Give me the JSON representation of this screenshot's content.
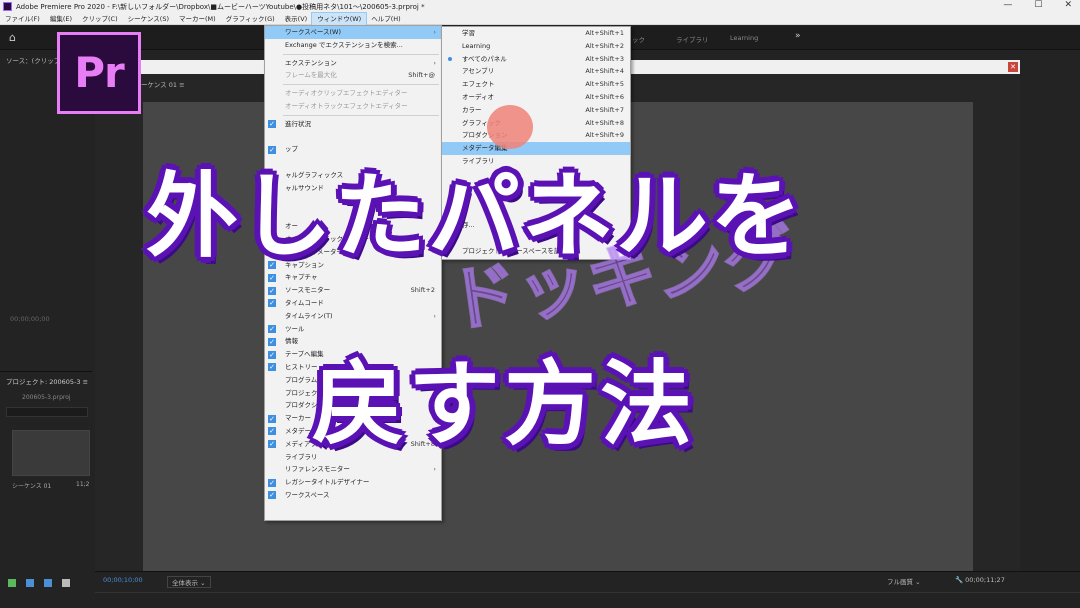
{
  "titlebar": {
    "title": "Adobe Premiere Pro 2020 - F:\\新しいフォルダー\\Dropbox\\■ムービーハーツYoutube\\●投稿用ネタ\\101～\\200605-3.prproj *",
    "min": "—",
    "max": "☐",
    "close": "✕"
  },
  "menubar": {
    "items": [
      "ファイル(F)",
      "編集(E)",
      "クリップ(C)",
      "シーケンス(S)",
      "マーカー(M)",
      "グラフィック(G)",
      "表示(V)",
      "ウィンドウ(W)",
      "ヘルプ(H)"
    ]
  },
  "workspacebar": {
    "home_icon": "⌂",
    "tabs": [
      "ック",
      "ライブラリ",
      "Learning"
    ],
    "more": "»"
  },
  "source_panel": {
    "tab": "ソース：(クリップ",
    "timecode": "00;00;00;00"
  },
  "program_panel": {
    "sequence": "ーケンス 01",
    "menu_icon": "≡"
  },
  "project_panel": {
    "tab": "プロジェクト: 200605-3",
    "menu_icon": "≡",
    "file": "200605-3.prproj",
    "sequence_label": "シーケンス 01",
    "sequence_duration": "11;2"
  },
  "bottom_bar": {
    "timecode_left": "00;00;10;00",
    "fit": "全体表示",
    "fit_arrow": "⌄",
    "quality": "フル画質",
    "quality_arrow": "⌄",
    "wrench_icon": "🔧",
    "timecode_right": "00;00;11;27"
  },
  "logo": {
    "text": "Pr"
  },
  "window_menu": {
    "items": [
      {
        "label": "ワークスペース(W)",
        "shortcut": "",
        "submenu": true,
        "checked": false,
        "disabled": false,
        "highlight": true
      },
      {
        "label": "Exchange でエクステンションを検索...",
        "shortcut": "",
        "submenu": false,
        "checked": false,
        "disabled": false
      },
      {
        "sep": true
      },
      {
        "label": "エクステンション",
        "shortcut": "",
        "submenu": true,
        "checked": false,
        "disabled": false
      },
      {
        "label": "フレームを最大化",
        "shortcut": "Shift+@",
        "submenu": false,
        "checked": false,
        "disabled": true
      },
      {
        "sep": true
      },
      {
        "label": "オーディオクリップエフェクトエディター",
        "shortcut": "",
        "submenu": false,
        "checked": false,
        "disabled": true
      },
      {
        "label": "オーディオトラックエフェクトエディター",
        "shortcut": "",
        "submenu": false,
        "checked": false,
        "disabled": true
      },
      {
        "sep": true
      },
      {
        "label": "進行状況",
        "shortcut": "",
        "submenu": false,
        "checked": true,
        "disabled": false
      },
      {
        "label": "",
        "shortcut": "",
        "submenu": false,
        "checked": false,
        "disabled": false
      },
      {
        "label": "ップ",
        "shortcut": "",
        "submenu": false,
        "checked": true,
        "disabled": false
      },
      {
        "label": "",
        "shortcut": "",
        "submenu": false,
        "checked": false,
        "disabled": false
      },
      {
        "label": "ャルグラフィックス",
        "shortcut": "",
        "submenu": false,
        "checked": true,
        "disabled": false
      },
      {
        "label": "ャルサウンド",
        "shortcut": "",
        "submenu": false,
        "checked": true,
        "disabled": false
      },
      {
        "label": "",
        "shortcut": "",
        "submenu": false,
        "checked": false,
        "disabled": false
      },
      {
        "label": "",
        "shortcut": "",
        "submenu": false,
        "checked": true,
        "disabled": false
      },
      {
        "label": "オー",
        "shortcut": "",
        "submenu": false,
        "checked": true,
        "disabled": false
      },
      {
        "label": "オーディオトラックミキサー",
        "shortcut": "",
        "submenu": true,
        "checked": false,
        "disabled": false
      },
      {
        "label": "オーディオメーター",
        "shortcut": "",
        "submenu": false,
        "checked": true,
        "disabled": false
      },
      {
        "label": "キャプション",
        "shortcut": "",
        "submenu": false,
        "checked": true,
        "disabled": false
      },
      {
        "label": "キャプチャ",
        "shortcut": "",
        "submenu": false,
        "checked": true,
        "disabled": false
      },
      {
        "label": "ソースモニター",
        "shortcut": "Shift+2",
        "submenu": false,
        "checked": true,
        "disabled": false
      },
      {
        "label": "タイムコード",
        "shortcut": "",
        "submenu": false,
        "checked": true,
        "disabled": false
      },
      {
        "label": "タイムライン(T)",
        "shortcut": "",
        "submenu": true,
        "checked": false,
        "disabled": false
      },
      {
        "label": "ツール",
        "shortcut": "",
        "submenu": false,
        "checked": true,
        "disabled": false
      },
      {
        "label": "情報",
        "shortcut": "",
        "submenu": false,
        "checked": true,
        "disabled": false
      },
      {
        "label": "テープへ編集",
        "shortcut": "",
        "submenu": false,
        "checked": true,
        "disabled": false
      },
      {
        "label": "ヒストリー",
        "shortcut": "",
        "submenu": false,
        "checked": true,
        "disabled": false
      },
      {
        "label": "プログラムモニ",
        "shortcut": "",
        "submenu": true,
        "checked": false,
        "disabled": false
      },
      {
        "label": "プロジェクト",
        "shortcut": "",
        "submenu": true,
        "checked": false,
        "disabled": false
      },
      {
        "label": "プロダクシ",
        "shortcut": "",
        "submenu": false,
        "checked": false,
        "disabled": false
      },
      {
        "label": "マーカー",
        "shortcut": "",
        "submenu": false,
        "checked": true,
        "disabled": false
      },
      {
        "label": "メタデータ",
        "shortcut": "",
        "submenu": false,
        "checked": true,
        "disabled": false
      },
      {
        "label": "メディアブラウザー",
        "shortcut": "Shift+8",
        "submenu": false,
        "checked": true,
        "disabled": false
      },
      {
        "label": "ライブラリ",
        "shortcut": "",
        "submenu": false,
        "checked": false,
        "disabled": false
      },
      {
        "label": "リファレンスモニター",
        "shortcut": "",
        "submenu": true,
        "checked": false,
        "disabled": false
      },
      {
        "label": "レガシータイトルデザイナー",
        "shortcut": "",
        "submenu": false,
        "checked": true,
        "disabled": false
      },
      {
        "label": "ワークスペース",
        "shortcut": "",
        "submenu": false,
        "checked": true,
        "disabled": false
      }
    ]
  },
  "workspace_menu": {
    "items": [
      {
        "label": "学習",
        "shortcut": "Alt+Shift+1",
        "dot": false,
        "highlight": false
      },
      {
        "label": "Learning",
        "shortcut": "Alt+Shift+2",
        "dot": false,
        "highlight": false
      },
      {
        "label": "すべてのパネル",
        "shortcut": "Alt+Shift+3",
        "dot": true,
        "highlight": false
      },
      {
        "label": "アセンブリ",
        "shortcut": "Alt+Shift+4",
        "dot": false,
        "highlight": false
      },
      {
        "label": "エフェクト",
        "shortcut": "Alt+Shift+5",
        "dot": false,
        "highlight": false
      },
      {
        "label": "オーディオ",
        "shortcut": "Alt+Shift+6",
        "dot": false,
        "highlight": false
      },
      {
        "label": "カラー",
        "shortcut": "Alt+Shift+7",
        "dot": false,
        "highlight": false
      },
      {
        "label": "グラフィック",
        "shortcut": "Alt+Shift+8",
        "dot": false,
        "highlight": false
      },
      {
        "label": "プロダクション",
        "shortcut": "Alt+Shift+9",
        "dot": false,
        "highlight": false
      },
      {
        "label": "メタデータ編集",
        "shortcut": "",
        "dot": false,
        "highlight": true
      },
      {
        "label": "ライブラリ",
        "shortcut": "",
        "dot": false,
        "highlight": false
      },
      {
        "label": "",
        "shortcut": "",
        "dot": false,
        "highlight": false
      },
      {
        "label": "",
        "shortcut": "",
        "dot": false,
        "highlight": false
      },
      {
        "label": "",
        "shortcut": "",
        "dot": false,
        "highlight": false
      },
      {
        "label": "",
        "shortcut": "",
        "dot": false,
        "highlight": false
      },
      {
        "label": "存...",
        "shortcut": "",
        "dot": false,
        "highlight": false
      },
      {
        "label": "",
        "shortcut": "",
        "dot": false,
        "highlight": false
      },
      {
        "label": "プロジェクトから ースペースを読み込み",
        "shortcut": "",
        "dot": false,
        "highlight": false
      }
    ]
  },
  "overlay": {
    "line1": "外したパネルを",
    "line2": "戻す方法",
    "ghost": "ドッキング",
    "colors": {
      "fill": "#ffffff",
      "outline": "#6a21c8"
    }
  }
}
